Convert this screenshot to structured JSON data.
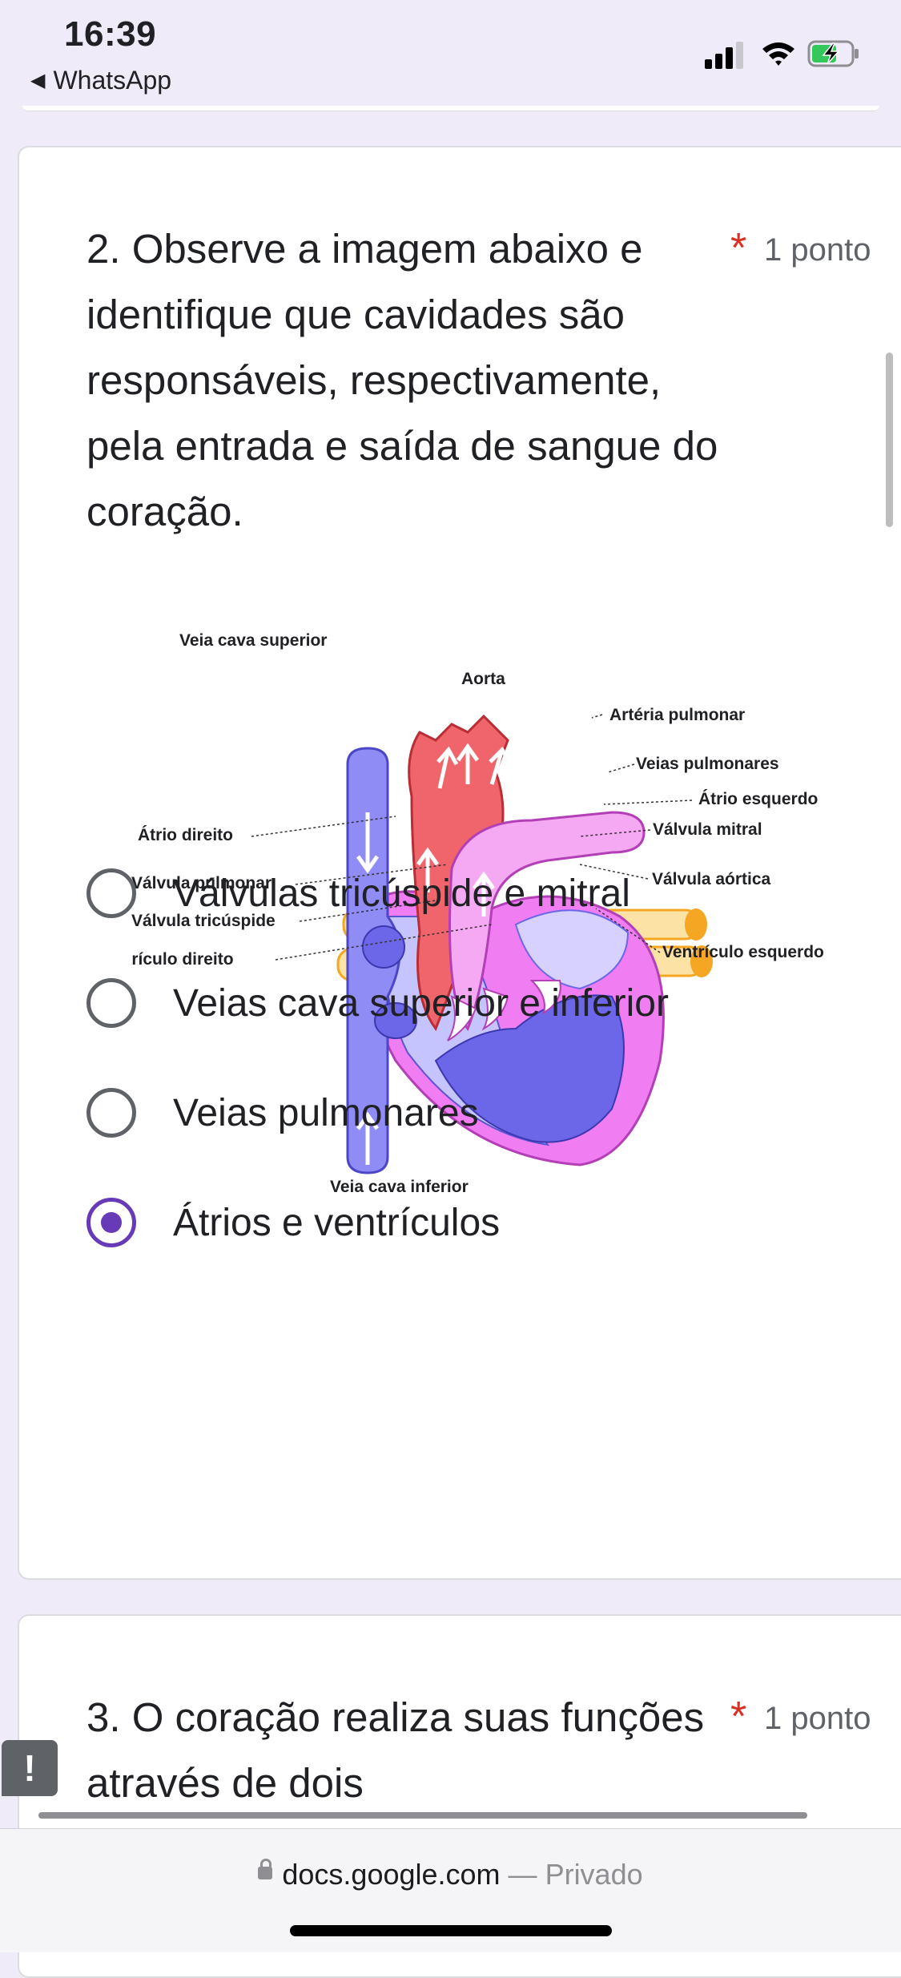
{
  "status_bar": {
    "time": "16:39",
    "back_app": "WhatsApp"
  },
  "question2": {
    "text": "2. Observe a imagem abaixo e identifique que cavidades são responsáveis, respectivamente, pela entrada e saída de sangue do coração.",
    "required_marker": "*",
    "points": "1 ponto",
    "diagram_labels": {
      "veia_cava_superior": "Veia cava superior",
      "aorta": "Aorta",
      "arteria_pulmonar": "Artéria pulmonar",
      "veias_pulmonares": "Veias pulmonares",
      "atrio_esquerdo": "Átrio esquerdo",
      "valvula_mitral": "Válvula mitral",
      "atrio_direito": "Átrio direito",
      "valvula_pulmonar": "Válvula pulmonar",
      "valvula_aortica": "Válvula aórtica",
      "valvula_tricuspide": "Válvula tricúspide",
      "ventriculo_direito": "Ventrículo direito",
      "ventriculo_esquerdo": "Ventrículo esquerdo",
      "veia_cava_inferior": "Veia cava inferior"
    },
    "options": [
      {
        "label": "Válvulas tricúspide e mitral",
        "selected": false
      },
      {
        "label": "Veias cava superior e inferior",
        "selected": false
      },
      {
        "label": "Veias pulmonares",
        "selected": false
      },
      {
        "label": "Átrios e ventrículos",
        "selected": true
      }
    ]
  },
  "question3": {
    "text": "3. O coração realiza suas funções através de dois",
    "required_marker": "*",
    "points": "1 ponto"
  },
  "feedback_icon": "!",
  "url_bar": {
    "domain": "docs.google.com",
    "separator": " — ",
    "privacy": "Privado"
  },
  "colors": {
    "accent": "#673ab7",
    "required": "#d93025",
    "background": "#f0ebf8"
  }
}
